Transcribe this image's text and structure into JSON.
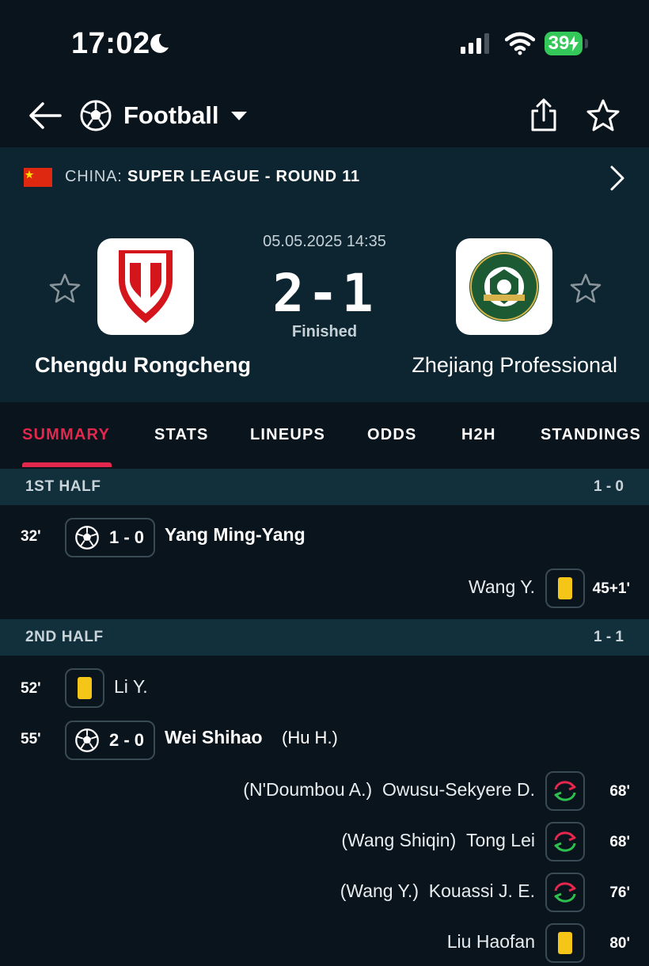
{
  "status_bar": {
    "time": "17:02",
    "battery": "39"
  },
  "nav": {
    "sport": "Football"
  },
  "league": {
    "country": "CHINA:",
    "name": "SUPER LEAGUE - ROUND 11"
  },
  "match": {
    "date": "05.05.2025 14:35",
    "score": "2-1",
    "status": "Finished",
    "home_team": "Chengdu Rongcheng",
    "away_team": "Zhejiang Professional"
  },
  "tabs": [
    "SUMMARY",
    "STATS",
    "LINEUPS",
    "ODDS",
    "H2H",
    "STANDINGS"
  ],
  "first_half": {
    "title": "1ST HALF",
    "score": "1 - 0",
    "events": [
      {
        "minute": "32'",
        "type": "goal",
        "score": "1 - 0",
        "player": "Yang Ming-Yang"
      },
      {
        "minute": "45+1'",
        "type": "yellow-card",
        "player": "Wang Y."
      }
    ]
  },
  "second_half": {
    "title": "2ND HALF",
    "score": "1 - 1",
    "events": [
      {
        "minute": "52'",
        "type": "yellow-card",
        "player": "Li Y."
      },
      {
        "minute": "55'",
        "type": "goal",
        "score": "2 - 0",
        "player": "Wei Shihao",
        "assist": "(Hu H.)"
      },
      {
        "minute": "68'",
        "type": "substitution",
        "player_in": "Owusu-Sekyere D.",
        "player_out": "(N'Doumbou A.)"
      },
      {
        "minute": "68'",
        "type": "substitution",
        "player_in": "Tong Lei",
        "player_out": "(Wang Shiqin)"
      },
      {
        "minute": "76'",
        "type": "substitution",
        "player_in": "Kouassi J. E.",
        "player_out": "(Wang Y.)"
      },
      {
        "minute": "80'",
        "type": "yellow-card",
        "player": "Liu Haofan"
      }
    ]
  },
  "icons": {
    "back": "arrow-left-icon",
    "ball": "soccer-ball-icon",
    "share": "share-icon",
    "favorite": "star-icon",
    "chevron": "chevron-right-icon",
    "card": "yellow-card-icon",
    "sub": "substitution-icon"
  },
  "colors": {
    "accent": "#e4274c",
    "background": "#0a141d",
    "panel": "#0d2530",
    "yellow_card": "#f5c518"
  }
}
